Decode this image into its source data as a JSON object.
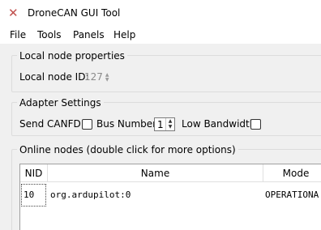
{
  "window": {
    "title": "DroneCAN GUI Tool",
    "icon": "dronecan-x-icon",
    "accent": "#c0504d"
  },
  "menu": {
    "items": [
      "File",
      "Tools",
      "Panels",
      "Help"
    ]
  },
  "local_node": {
    "title": "Local node properties",
    "id_label": "Local node ID:",
    "id_value": "127"
  },
  "adapter": {
    "title": "Adapter Settings",
    "canfd_label": "Send CANFD:",
    "canfd_checked": false,
    "bus_label": "Bus Number:",
    "bus_value": "1",
    "low_bw_label": "Low Bandwidth:",
    "low_bw_checked": false
  },
  "online_nodes": {
    "title": "Online nodes (double click for more options)",
    "columns": [
      "NID",
      "Name",
      "Mode"
    ],
    "rows": [
      {
        "nid": "10",
        "name": "org.ardupilot:0",
        "mode": "OPERATIONA"
      }
    ]
  }
}
